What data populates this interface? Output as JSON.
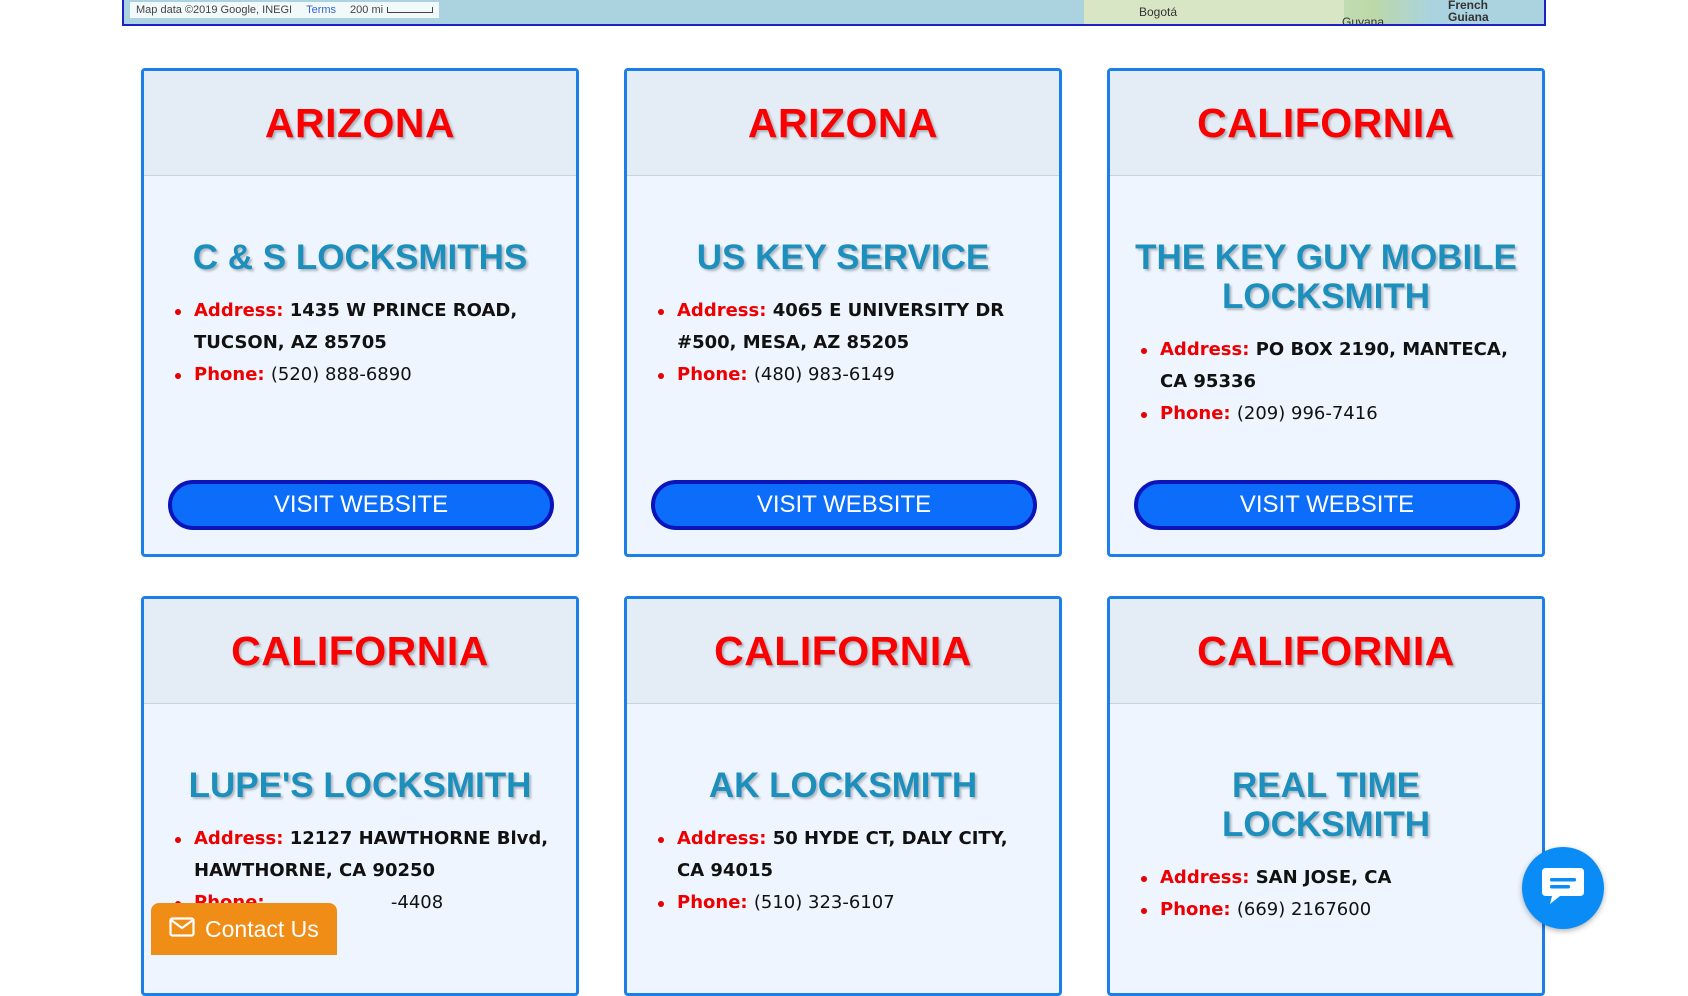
{
  "map": {
    "attribution": "Map data ©2019 Google, INEGI",
    "terms": "Terms",
    "scale": "200 mi",
    "labels": [
      "Bogotá",
      "Guyana",
      "French Guiana"
    ]
  },
  "cards": [
    {
      "state": "ARIZONA",
      "name": "C & S LOCKSMITHS",
      "address_label": "Address:",
      "address": "1435 W PRINCE ROAD, TUCSON, AZ 85705",
      "phone_label": "Phone:",
      "phone": "(520) 888-6890",
      "button": "VISIT WEBSITE"
    },
    {
      "state": "ARIZONA",
      "name": "US KEY SERVICE",
      "address_label": "Address:",
      "address": "4065 E UNIVERSITY DR #500, MESA, AZ 85205",
      "phone_label": "Phone:",
      "phone": "(480) 983-6149",
      "button": "VISIT WEBSITE"
    },
    {
      "state": "CALIFORNIA",
      "name": "THE KEY GUY MOBILE LOCKSMITH",
      "address_label": "Address:",
      "address": "PO BOX 2190, MANTECA, CA 95336",
      "phone_label": "Phone:",
      "phone": "(209) 996-7416",
      "button": "VISIT WEBSITE"
    },
    {
      "state": "CALIFORNIA",
      "name": "LUPE'S LOCKSMITH",
      "address_label": "Address:",
      "address": "12127 HAWTHORNE Blvd, HAWTHORNE, CA 90250",
      "phone_label": "Phone:",
      "phone": "-4408"
    },
    {
      "state": "CALIFORNIA",
      "name": "AK LOCKSMITH",
      "address_label": "Address:",
      "address": "50 HYDE CT, DALY CITY, CA 94015",
      "phone_label": "Phone:",
      "phone": "(510) 323-6107"
    },
    {
      "state": "CALIFORNIA",
      "name": "REAL TIME LOCKSMITH",
      "address_label": "Address:",
      "address": "SAN JOSE, CA",
      "phone_label": "Phone:",
      "phone": "(669) 2167600"
    }
  ],
  "contact": {
    "label": "Contact Us",
    "icon": "envelope-icon"
  },
  "chat": {
    "icon": "chat-bubble-icon"
  },
  "colors": {
    "state": "#fb0000",
    "business": "#1c8fbd",
    "card_border": "#1c7ee8",
    "button": "#0b6dfa",
    "contact": "#f08d17",
    "chat": "#0a8cf6"
  }
}
